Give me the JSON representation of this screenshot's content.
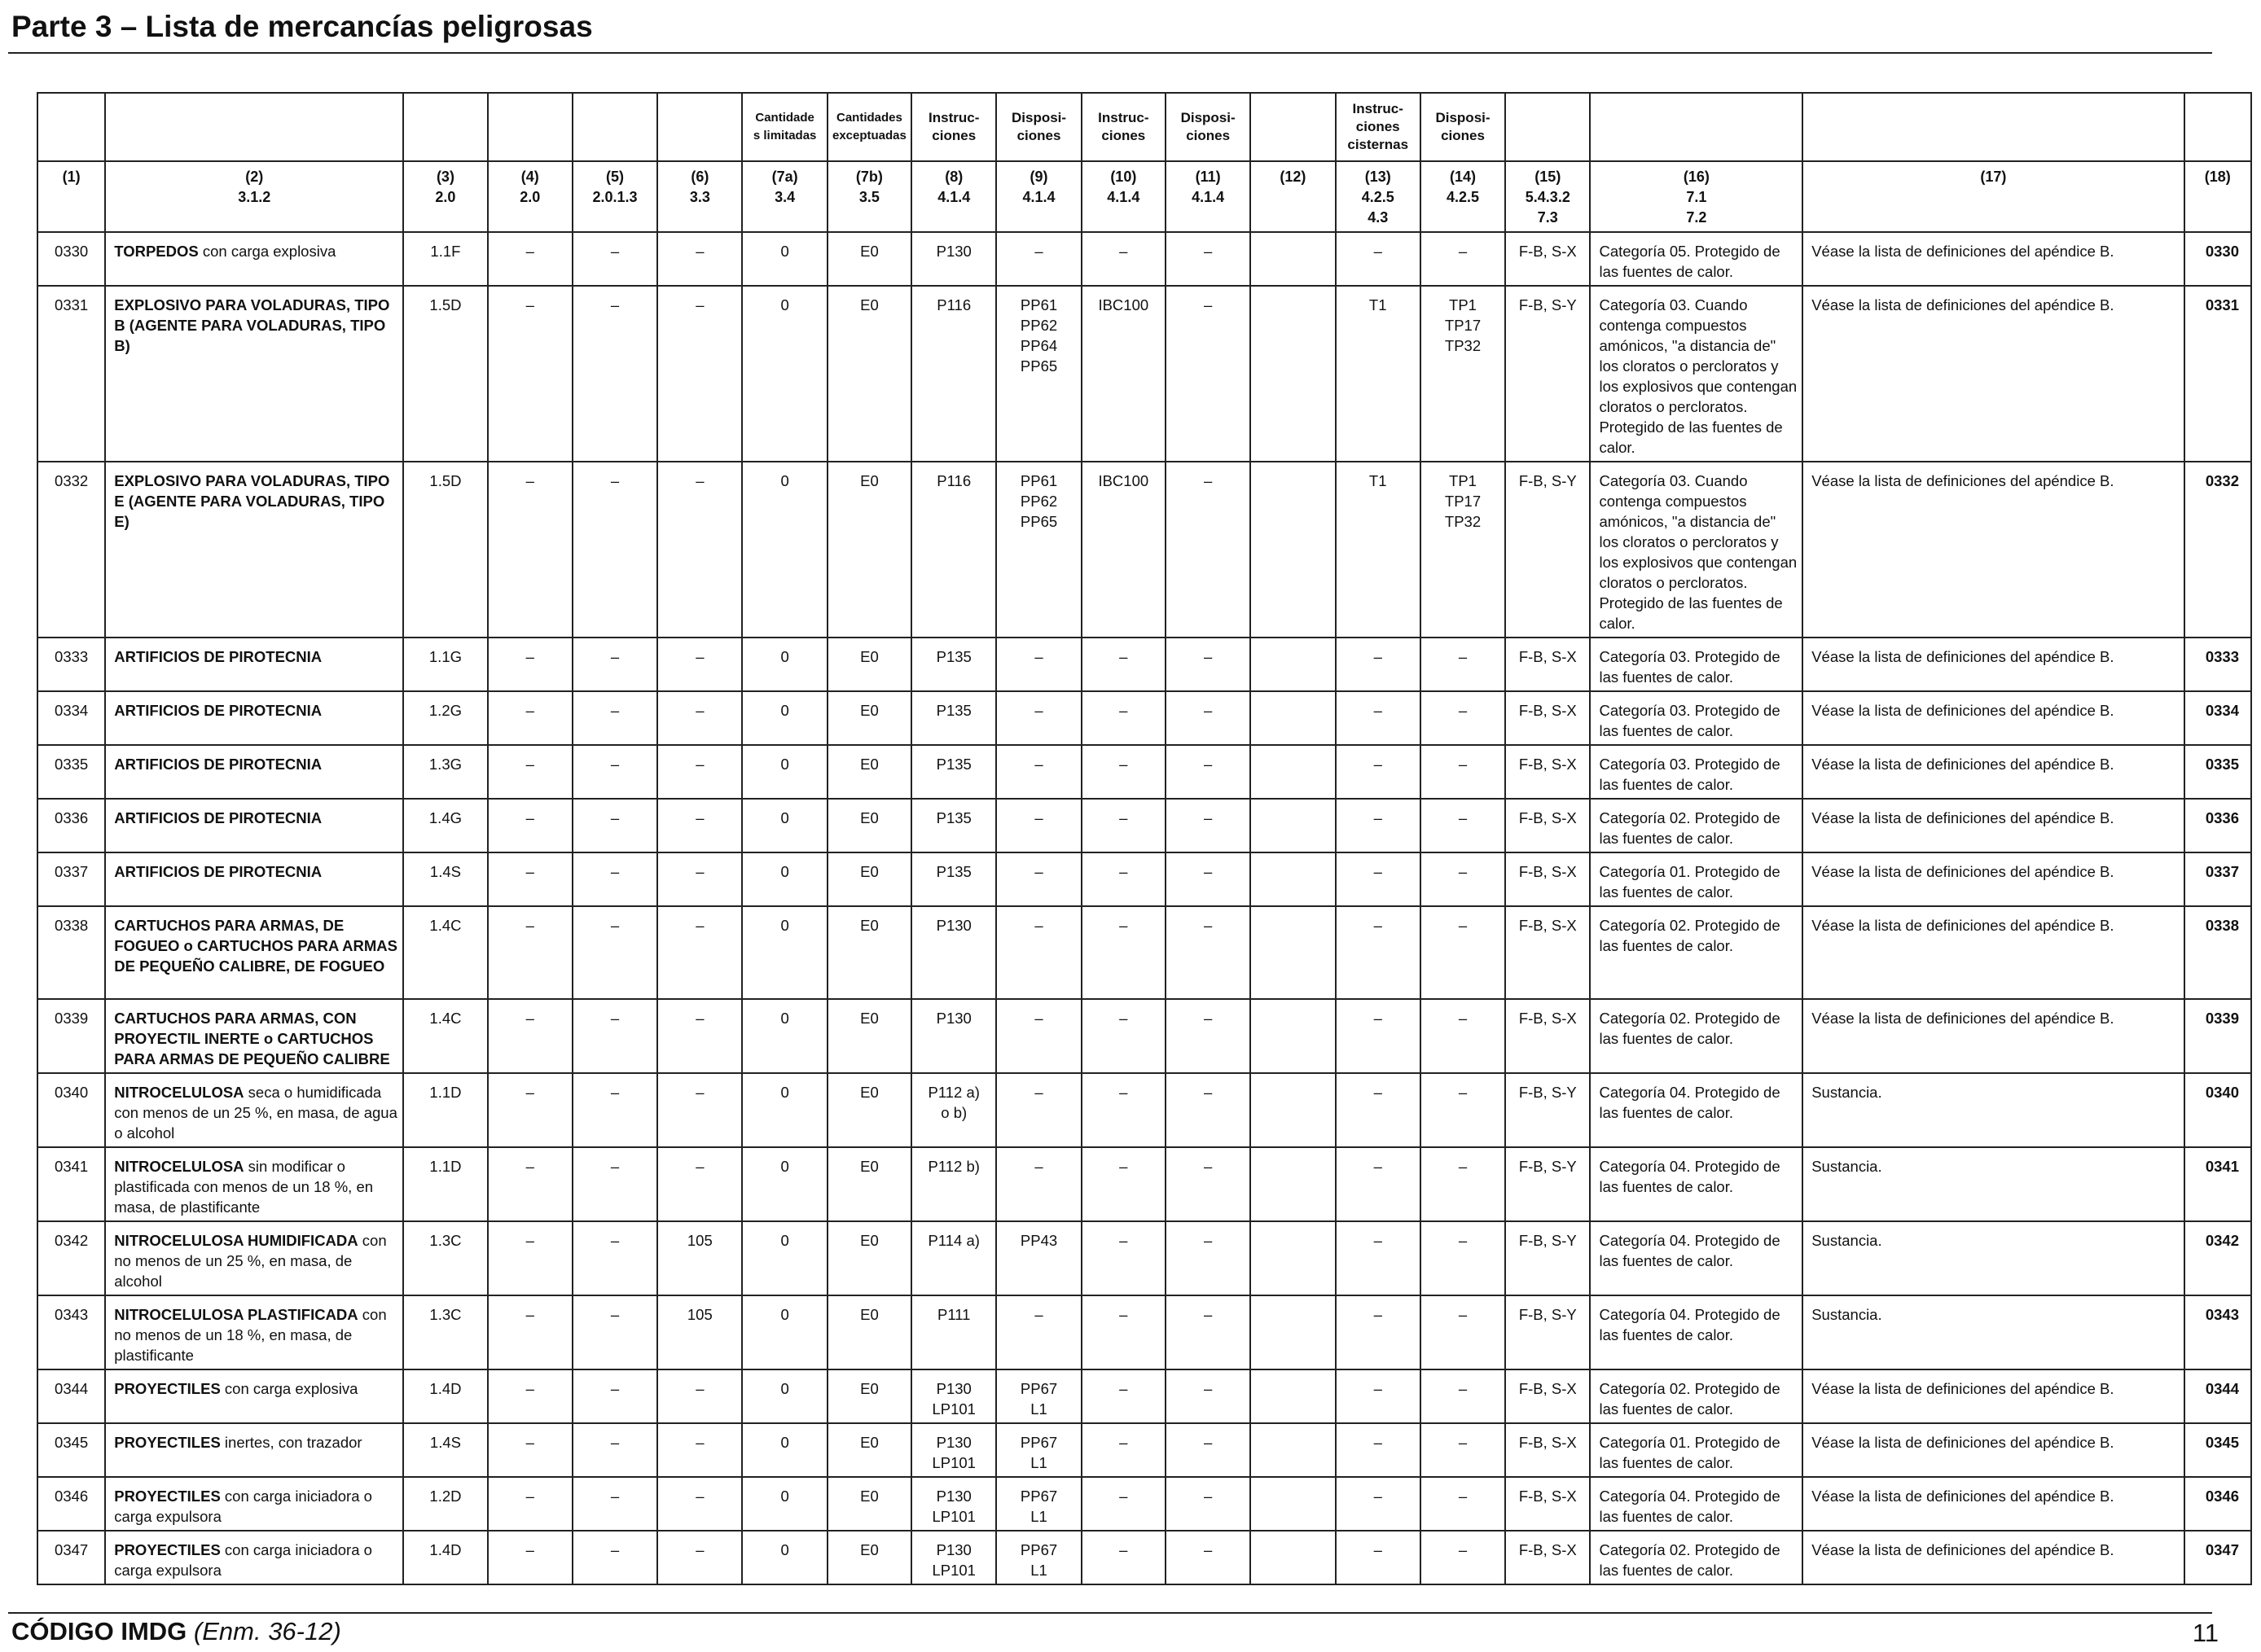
{
  "page_title": "Parte 3 – Lista de mercancías peligrosas",
  "footer": {
    "code": "CÓDIGO IMDG",
    "edition": "(Enm. 36-12)",
    "page_number": "11"
  },
  "table": {
    "header_names": [
      "",
      "",
      "",
      "",
      "",
      "",
      "Cantidade\ns limitadas",
      "Cantidades\nexceptuadas",
      "Instruc-\nciones",
      "Disposi-\nciones",
      "Instruc-\nciones",
      "Disposi-\nciones",
      "",
      "Instruc-\nciones\ncisternas",
      "Disposi-\nciones",
      "",
      "",
      "",
      ""
    ],
    "header_refs": [
      "(1)",
      "(2)\n3.1.2",
      "(3)\n2.0",
      "(4)\n2.0",
      "(5)\n2.0.1.3",
      "(6)\n3.3",
      "(7a)\n3.4",
      "(7b)\n3.5",
      "(8)\n4.1.4",
      "(9)\n4.1.4",
      "(10)\n4.1.4",
      "(11)\n4.1.4",
      "(12)",
      "(13)\n4.2.5\n4.3",
      "(14)\n4.2.5",
      "(15)\n5.4.3.2\n7.3",
      "(16)\n7.1\n7.2",
      "(17)",
      "(18)"
    ],
    "rows": [
      {
        "un": "0330",
        "name_bold": "TORPEDOS",
        "name_rest": " con carga explosiva",
        "cls": "1.1F",
        "c4": "–",
        "c5": "–",
        "c6": "–",
        "c7a": "0",
        "c7b": "E0",
        "c8": "P130",
        "c9": "–",
        "c10": "–",
        "c11": "–",
        "c12": "",
        "c13": "–",
        "c14": "–",
        "c15": "F-B, S-X",
        "c16": "Categoría 05. Protegido de las fuentes de calor.",
        "c17": "Véase la lista de definiciones del apéndice B.",
        "c18": "0330"
      },
      {
        "un": "0331",
        "name_bold": "EXPLOSIVO PARA VOLADURAS, TIPO B (AGENTE PARA VOLADURAS, TIPO B)",
        "name_rest": "",
        "cls": "1.5D",
        "c4": "–",
        "c5": "–",
        "c6": "–",
        "c7a": "0",
        "c7b": "E0",
        "c8": "P116",
        "c9": "PP61\nPP62\nPP64\nPP65",
        "c10": "IBC100",
        "c11": "–",
        "c12": "",
        "c13": "T1",
        "c14": "TP1\nTP17\nTP32",
        "c15": "F-B, S-Y",
        "c16": "Categoría 03. Cuando contenga compuestos amónicos, \"a distancia de\" los cloratos o percloratos y los explosivos que contengan cloratos o percloratos. Protegido de las fuentes de calor.",
        "c17": "Véase la lista de definiciones del apéndice B.",
        "c18": "0331"
      },
      {
        "un": "0332",
        "name_bold": "EXPLOSIVO PARA VOLADURAS, TIPO E (AGENTE PARA VOLADURAS, TIPO E)",
        "name_rest": "",
        "cls": "1.5D",
        "c4": "–",
        "c5": "–",
        "c6": "–",
        "c7a": "0",
        "c7b": "E0",
        "c8": "P116",
        "c9": "PP61\nPP62\nPP65",
        "c10": "IBC100",
        "c11": "–",
        "c12": "",
        "c13": "T1",
        "c14": "TP1\nTP17\nTP32",
        "c15": "F-B, S-Y",
        "c16": "Categoría 03. Cuando contenga compuestos amónicos, \"a distancia de\" los cloratos o percloratos y los explosivos que contengan cloratos o percloratos. Protegido de las fuentes de calor.",
        "c17": "Véase la lista de definiciones del apéndice B.",
        "c18": "0332"
      },
      {
        "un": "0333",
        "name_bold": "ARTIFICIOS DE PIROTECNIA",
        "name_rest": "",
        "cls": "1.1G",
        "c4": "–",
        "c5": "–",
        "c6": "–",
        "c7a": "0",
        "c7b": "E0",
        "c8": "P135",
        "c9": "–",
        "c10": "–",
        "c11": "–",
        "c12": "",
        "c13": "–",
        "c14": "–",
        "c15": "F-B, S-X",
        "c16": "Categoría 03. Protegido de las fuentes de calor.",
        "c17": "Véase la lista de definiciones del apéndice B.",
        "c18": "0333"
      },
      {
        "un": "0334",
        "name_bold": "ARTIFICIOS DE PIROTECNIA",
        "name_rest": "",
        "cls": "1.2G",
        "c4": "–",
        "c5": "–",
        "c6": "–",
        "c7a": "0",
        "c7b": "E0",
        "c8": "P135",
        "c9": "–",
        "c10": "–",
        "c11": "–",
        "c12": "",
        "c13": "–",
        "c14": "–",
        "c15": "F-B, S-X",
        "c16": "Categoría 03. Protegido de las fuentes de calor.",
        "c17": "Véase la lista de definiciones del apéndice B.",
        "c18": "0334"
      },
      {
        "un": "0335",
        "name_bold": "ARTIFICIOS DE PIROTECNIA",
        "name_rest": "",
        "cls": "1.3G",
        "c4": "–",
        "c5": "–",
        "c6": "–",
        "c7a": "0",
        "c7b": "E0",
        "c8": "P135",
        "c9": "–",
        "c10": "–",
        "c11": "–",
        "c12": "",
        "c13": "–",
        "c14": "–",
        "c15": "F-B, S-X",
        "c16": "Categoría 03. Protegido de las fuentes de calor.",
        "c17": "Véase la lista de definiciones del apéndice B.",
        "c18": "0335"
      },
      {
        "un": "0336",
        "name_bold": "ARTIFICIOS DE PIROTECNIA",
        "name_rest": "",
        "cls": "1.4G",
        "c4": "–",
        "c5": "–",
        "c6": "–",
        "c7a": "0",
        "c7b": "E0",
        "c8": "P135",
        "c9": "–",
        "c10": "–",
        "c11": "–",
        "c12": "",
        "c13": "–",
        "c14": "–",
        "c15": "F-B, S-X",
        "c16": "Categoría 02. Protegido de las fuentes de calor.",
        "c17": "Véase la lista de definiciones del apéndice B.",
        "c18": "0336"
      },
      {
        "un": "0337",
        "name_bold": "ARTIFICIOS DE PIROTECNIA",
        "name_rest": "",
        "cls": "1.4S",
        "c4": "–",
        "c5": "–",
        "c6": "–",
        "c7a": "0",
        "c7b": "E0",
        "c8": "P135",
        "c9": "–",
        "c10": "–",
        "c11": "–",
        "c12": "",
        "c13": "–",
        "c14": "–",
        "c15": "F-B, S-X",
        "c16": "Categoría 01. Protegido de las fuentes de calor.",
        "c17": "Véase la lista de definiciones del apéndice B.",
        "c18": "0337"
      },
      {
        "un": "0338",
        "name_bold": "CARTUCHOS PARA ARMAS, DE FOGUEO o CARTUCHOS PARA ARMAS DE PEQUEÑO CALIBRE, DE FOGUEO",
        "name_rest": "",
        "cls": "1.4C",
        "c4": "–",
        "c5": "–",
        "c6": "–",
        "c7a": "0",
        "c7b": "E0",
        "c8": "P130",
        "c9": "–",
        "c10": "–",
        "c11": "–",
        "c12": "",
        "c13": "–",
        "c14": "–",
        "c15": "F-B, S-X",
        "c16": "Categoría 02. Protegido de las fuentes de calor.",
        "c17": "Véase la lista de definiciones del apéndice B.",
        "c18": "0338"
      },
      {
        "un": "0339",
        "name_bold": "CARTUCHOS PARA ARMAS, CON PROYECTIL INERTE o CARTUCHOS PARA ARMAS DE PEQUEÑO CALIBRE",
        "name_rest": "",
        "cls": "1.4C",
        "c4": "–",
        "c5": "–",
        "c6": "–",
        "c7a": "0",
        "c7b": "E0",
        "c8": "P130",
        "c9": "–",
        "c10": "–",
        "c11": "–",
        "c12": "",
        "c13": "–",
        "c14": "–",
        "c15": "F-B, S-X",
        "c16": "Categoría 02. Protegido de las fuentes de calor.",
        "c17": "Véase la lista de definiciones del apéndice B.",
        "c18": "0339"
      },
      {
        "un": "0340",
        "name_bold": "NITROCELULOSA",
        "name_rest": " seca o humidificada con menos de un 25 %, en masa, de agua o alcohol",
        "cls": "1.1D",
        "c4": "–",
        "c5": "–",
        "c6": "–",
        "c7a": "0",
        "c7b": "E0",
        "c8": "P112 a)\no b)",
        "c9": "–",
        "c10": "–",
        "c11": "–",
        "c12": "",
        "c13": "–",
        "c14": "–",
        "c15": "F-B, S-Y",
        "c16": "Categoría 04. Protegido de las fuentes de calor.",
        "c17": "Sustancia.",
        "c18": "0340"
      },
      {
        "un": "0341",
        "name_bold": "NITROCELULOSA",
        "name_rest": " sin modificar o plastificada con menos de un 18 %, en masa, de plastificante",
        "cls": "1.1D",
        "c4": "–",
        "c5": "–",
        "c6": "–",
        "c7a": "0",
        "c7b": "E0",
        "c8": "P112 b)",
        "c9": "–",
        "c10": "–",
        "c11": "–",
        "c12": "",
        "c13": "–",
        "c14": "–",
        "c15": "F-B, S-Y",
        "c16": "Categoría 04. Protegido de las fuentes de calor.",
        "c17": "Sustancia.",
        "c18": "0341"
      },
      {
        "un": "0342",
        "name_bold": "NITROCELULOSA HUMIDIFICADA",
        "name_rest": " con no menos de un 25 %, en masa, de alcohol",
        "cls": "1.3C",
        "c4": "–",
        "c5": "–",
        "c6": "105",
        "c7a": "0",
        "c7b": "E0",
        "c8": "P114 a)",
        "c9": "PP43",
        "c10": "–",
        "c11": "–",
        "c12": "",
        "c13": "–",
        "c14": "–",
        "c15": "F-B, S-Y",
        "c16": "Categoría 04. Protegido de las fuentes de calor.",
        "c17": "Sustancia.",
        "c18": "0342"
      },
      {
        "un": "0343",
        "name_bold": "NITROCELULOSA PLASTIFICADA",
        "name_rest": " con no menos de un 18 %, en masa, de plastificante",
        "cls": "1.3C",
        "c4": "–",
        "c5": "–",
        "c6": "105",
        "c7a": "0",
        "c7b": "E0",
        "c8": "P111",
        "c9": "–",
        "c10": "–",
        "c11": "–",
        "c12": "",
        "c13": "–",
        "c14": "–",
        "c15": "F-B, S-Y",
        "c16": "Categoría 04. Protegido de las fuentes de calor.",
        "c17": "Sustancia.",
        "c18": "0343"
      },
      {
        "un": "0344",
        "name_bold": "PROYECTILES",
        "name_rest": " con carga explosiva",
        "cls": "1.4D",
        "c4": "–",
        "c5": "–",
        "c6": "–",
        "c7a": "0",
        "c7b": "E0",
        "c8": "P130\nLP101",
        "c9": "PP67\nL1",
        "c10": "–",
        "c11": "–",
        "c12": "",
        "c13": "–",
        "c14": "–",
        "c15": "F-B, S-X",
        "c16": "Categoría 02. Protegido de las fuentes de calor.",
        "c17": "Véase la lista de definiciones del apéndice B.",
        "c18": "0344"
      },
      {
        "un": "0345",
        "name_bold": "PROYECTILES",
        "name_rest": " inertes, con trazador",
        "cls": "1.4S",
        "c4": "–",
        "c5": "–",
        "c6": "–",
        "c7a": "0",
        "c7b": "E0",
        "c8": "P130\nLP101",
        "c9": "PP67\nL1",
        "c10": "–",
        "c11": "–",
        "c12": "",
        "c13": "–",
        "c14": "–",
        "c15": "F-B, S-X",
        "c16": "Categoría 01. Protegido de las fuentes de calor.",
        "c17": "Véase la lista de definiciones del apéndice B.",
        "c18": "0345"
      },
      {
        "un": "0346",
        "name_bold": "PROYECTILES",
        "name_rest": " con carga iniciadora o carga expulsora",
        "cls": "1.2D",
        "c4": "–",
        "c5": "–",
        "c6": "–",
        "c7a": "0",
        "c7b": "E0",
        "c8": "P130\nLP101",
        "c9": "PP67\nL1",
        "c10": "–",
        "c11": "–",
        "c12": "",
        "c13": "–",
        "c14": "–",
        "c15": "F-B, S-X",
        "c16": "Categoría 04. Protegido de las fuentes de calor.",
        "c17": "Véase la lista de definiciones del apéndice B.",
        "c18": "0346"
      },
      {
        "un": "0347",
        "name_bold": "PROYECTILES",
        "name_rest": " con carga iniciadora o carga expulsora",
        "cls": "1.4D",
        "c4": "–",
        "c5": "–",
        "c6": "–",
        "c7a": "0",
        "c7b": "E0",
        "c8": "P130\nLP101",
        "c9": "PP67\nL1",
        "c10": "–",
        "c11": "–",
        "c12": "",
        "c13": "–",
        "c14": "–",
        "c15": "F-B, S-X",
        "c16": "Categoría 02. Protegido de las fuentes de calor.",
        "c17": "Véase la lista de definiciones del apéndice B.",
        "c18": "0347"
      }
    ]
  }
}
